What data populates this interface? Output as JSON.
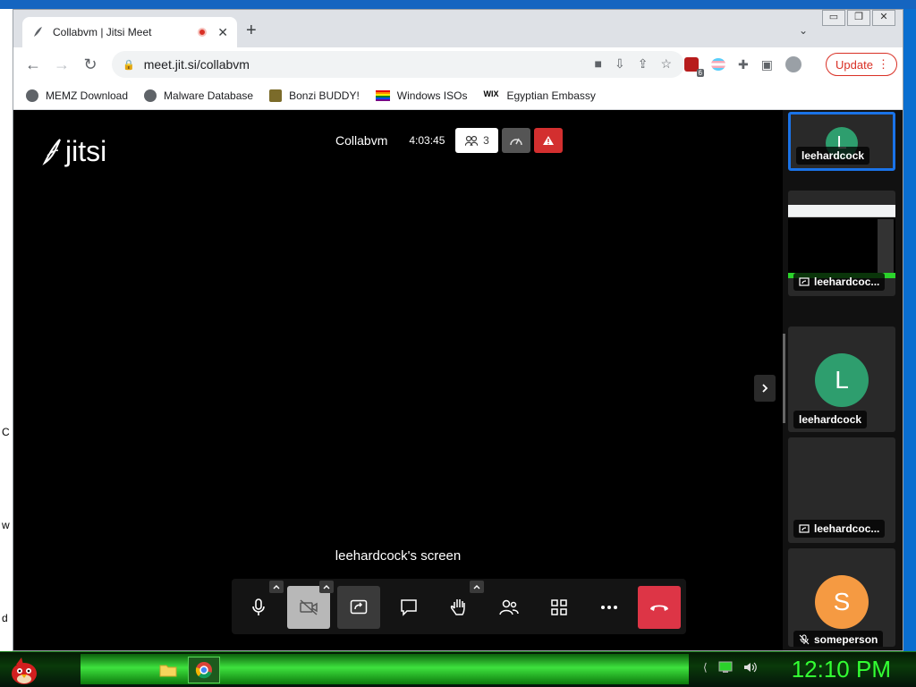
{
  "browser": {
    "tab_title": "Collabvm | Jitsi Meet",
    "url": "meet.jit.si/collabvm",
    "update_label": "Update",
    "extension_badge": "6",
    "bookmarks": [
      {
        "label": "MEMZ Download",
        "icon": "globe-icon"
      },
      {
        "label": "Malware Database",
        "icon": "globe-icon"
      },
      {
        "label": "Bonzi BUDDY!",
        "icon": "bonzi-icon"
      },
      {
        "label": "Windows ISOs",
        "icon": "rainbow-flag-icon"
      },
      {
        "label": "Egyptian Embassy",
        "icon": "wix-icon"
      }
    ]
  },
  "meeting": {
    "logo_text": "jitsi",
    "room_name": "Collabvm",
    "duration": "4:03:45",
    "participant_count": "3",
    "screen_label": "leehardcock's screen"
  },
  "filmstrip": [
    {
      "name": "leehardcock",
      "initial": "L",
      "type": "avatar",
      "active": true
    },
    {
      "name": "leehardcoc...",
      "type": "screen"
    },
    {
      "name": "leehardcock",
      "initial": "L",
      "type": "avatar"
    },
    {
      "name": "leehardcoc...",
      "type": "screen-empty"
    },
    {
      "name": "someperson",
      "initial": "S",
      "type": "avatar",
      "muted": true
    }
  ],
  "colors": {
    "avatar_green": "#2e9e6e",
    "avatar_orange": "#f59a42",
    "hangup_red": "#dd3546",
    "clock_green": "#33ff33"
  },
  "desktop": {
    "left_letters": [
      "C",
      "w",
      "d"
    ]
  },
  "taskbar": {
    "clock": "12:10 PM"
  }
}
